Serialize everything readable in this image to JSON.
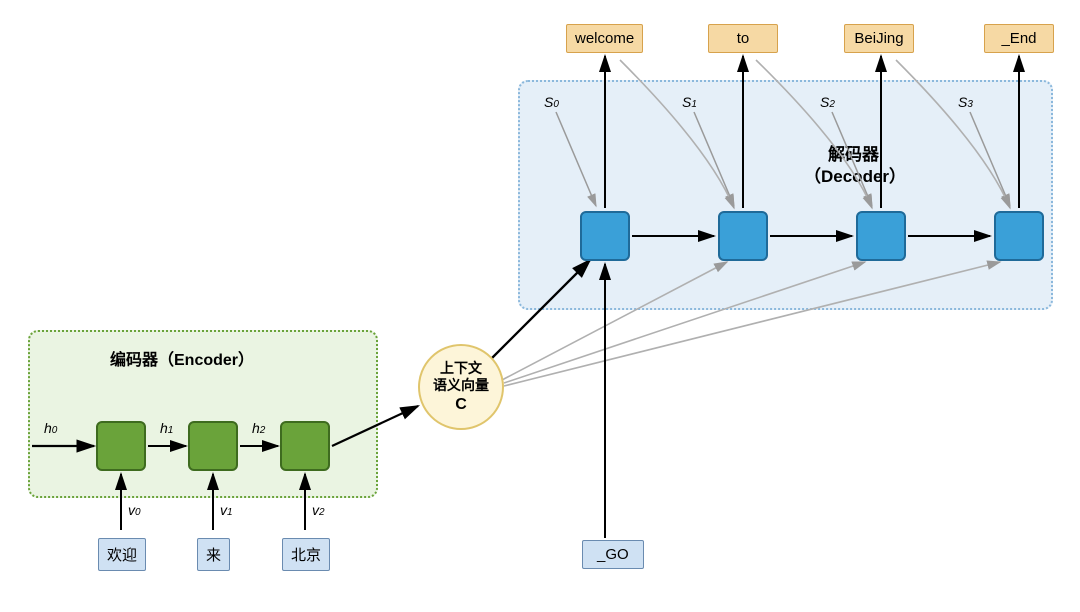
{
  "encoder": {
    "label": "编码器（Encoder）",
    "h": [
      "h",
      "h",
      "h"
    ],
    "h_sub": [
      "0",
      "1",
      "2"
    ],
    "v": [
      "v",
      "v",
      "v"
    ],
    "v_sub": [
      "0",
      "1",
      "2"
    ],
    "tokens": [
      "欢迎",
      "来",
      "北京"
    ]
  },
  "context": {
    "line1": "上下文",
    "line2": "语义向量",
    "line3": "C"
  },
  "decoder": {
    "label1": "解码器",
    "label2": "（Decoder）",
    "s": [
      "S",
      "S",
      "S",
      "S"
    ],
    "s_sub": [
      "0",
      "1",
      "2",
      "3"
    ],
    "outputs": [
      "welcome",
      "to",
      "BeiJing",
      "_End"
    ],
    "go_token": "_GO"
  }
}
